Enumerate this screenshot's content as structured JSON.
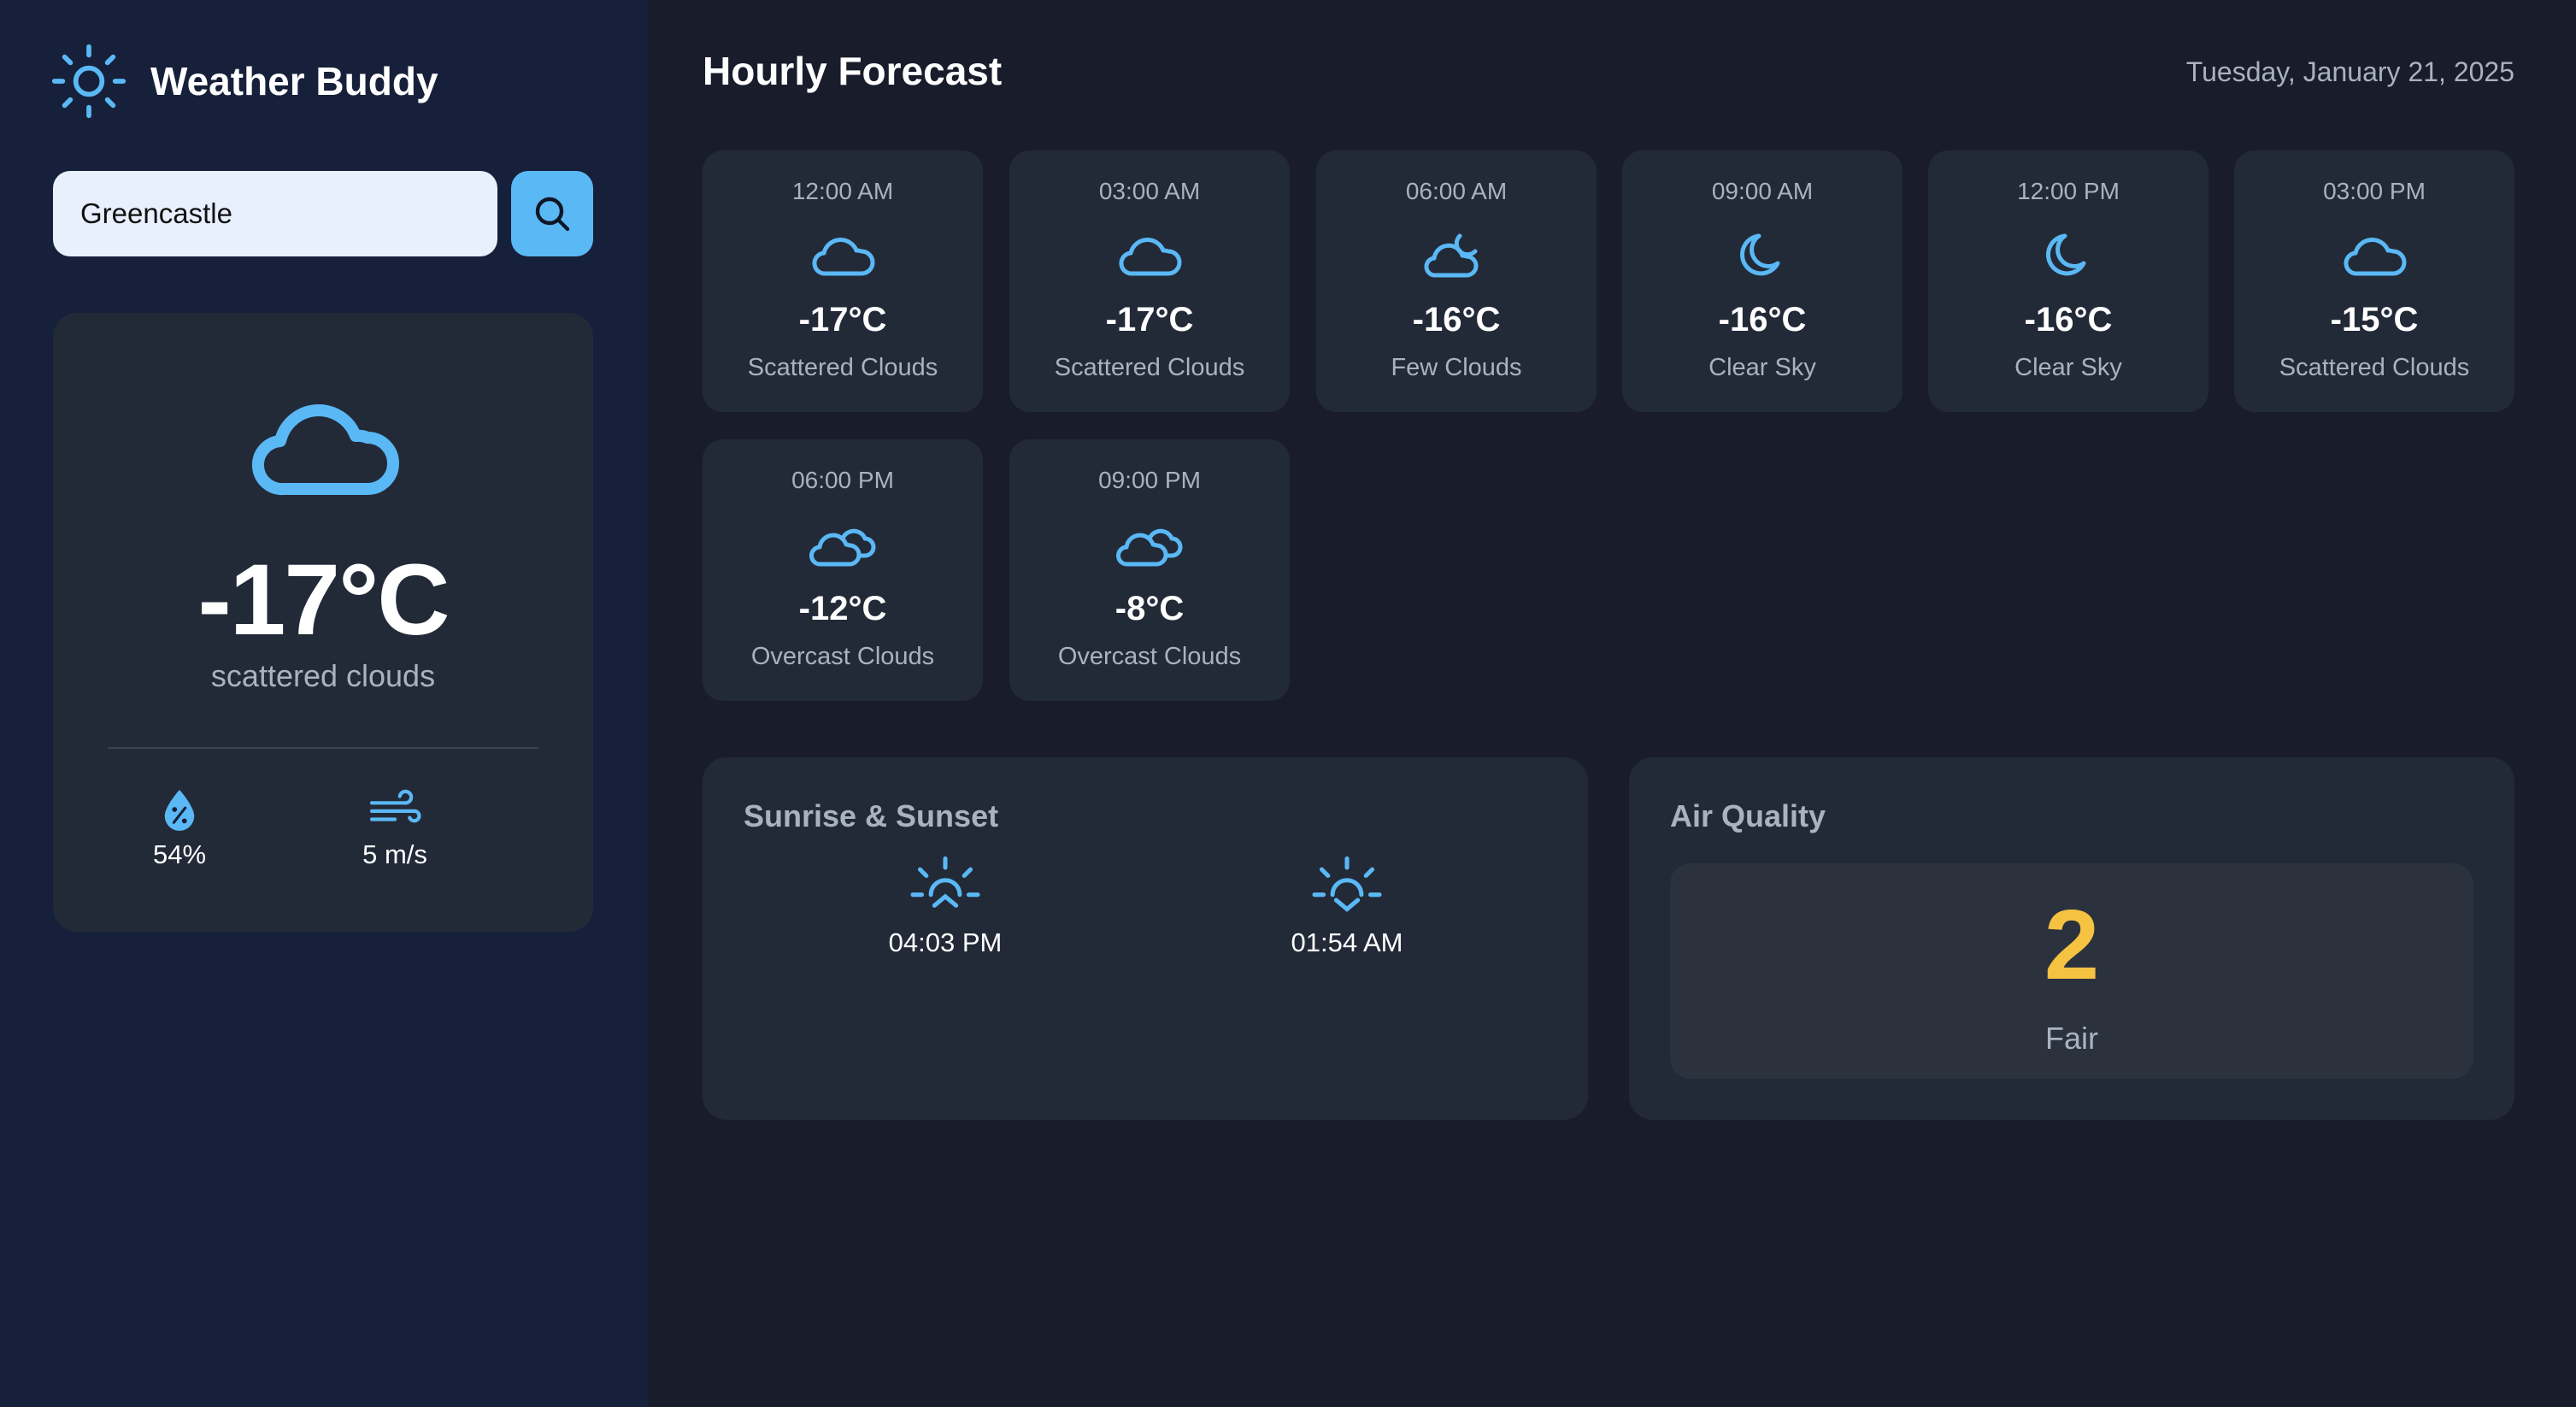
{
  "app": {
    "name": "Weather Buddy",
    "logo_icon": "sun-icon",
    "accent_color": "#5ab8f5"
  },
  "search": {
    "value": "Greencastle",
    "button_icon": "search-icon"
  },
  "current": {
    "icon": "cloud-icon",
    "temperature": "-17°C",
    "description": "scattered clouds",
    "humidity": "54%",
    "humidity_icon": "humidity-drop-icon",
    "wind": "5 m/s",
    "wind_icon": "wind-icon"
  },
  "forecast": {
    "title": "Hourly Forecast",
    "date": "Tuesday, January 21, 2025",
    "hours": [
      {
        "time": "12:00 AM",
        "icon": "cloud-icon",
        "temp": "-17°C",
        "desc": "Scattered Clouds"
      },
      {
        "time": "03:00 AM",
        "icon": "cloud-icon",
        "temp": "-17°C",
        "desc": "Scattered Clouds"
      },
      {
        "time": "06:00 AM",
        "icon": "cloud-moon-icon",
        "temp": "-16°C",
        "desc": "Few Clouds"
      },
      {
        "time": "09:00 AM",
        "icon": "moon-icon",
        "temp": "-16°C",
        "desc": "Clear Sky"
      },
      {
        "time": "12:00 PM",
        "icon": "moon-icon",
        "temp": "-16°C",
        "desc": "Clear Sky"
      },
      {
        "time": "03:00 PM",
        "icon": "cloud-icon",
        "temp": "-15°C",
        "desc": "Scattered Clouds"
      },
      {
        "time": "06:00 PM",
        "icon": "clouds-icon",
        "temp": "-12°C",
        "desc": "Overcast Clouds"
      },
      {
        "time": "09:00 PM",
        "icon": "clouds-icon",
        "temp": "-8°C",
        "desc": "Overcast Clouds"
      }
    ]
  },
  "sun": {
    "title": "Sunrise & Sunset",
    "sunrise": "04:03 PM",
    "sunrise_icon": "sunrise-icon",
    "sunset": "01:54 AM",
    "sunset_icon": "sunset-icon"
  },
  "air_quality": {
    "title": "Air Quality",
    "value": "2",
    "label": "Fair",
    "value_color": "#f5c242"
  }
}
